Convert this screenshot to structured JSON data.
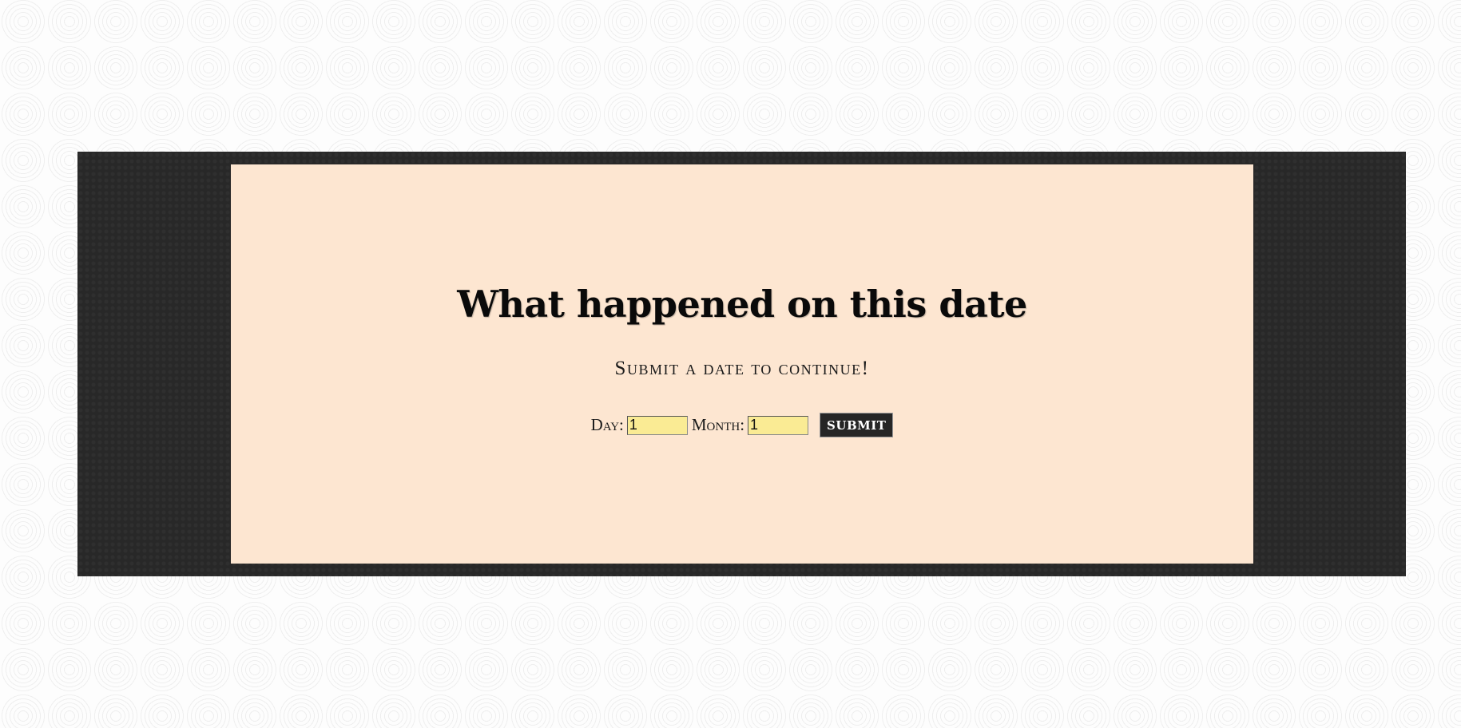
{
  "page": {
    "heading": "What happened on this date",
    "subtitle": "Submit a date to continue!"
  },
  "form": {
    "day_label": "Day:",
    "day_value": "1",
    "month_label": "Month:",
    "month_value": "1",
    "submit_label": "SUBMIT"
  },
  "colors": {
    "page_background": "#fdfdfd",
    "frame_background": "#282828",
    "card_background": "#fde6d1",
    "input_background": "#faeb94",
    "button_background": "#262626"
  }
}
